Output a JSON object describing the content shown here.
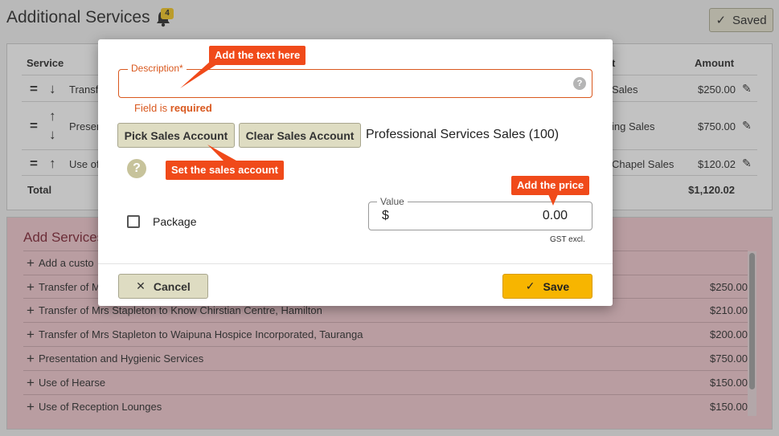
{
  "page": {
    "title": "Additional Services",
    "notification_count": "4",
    "saved_label": "Saved"
  },
  "table": {
    "headers": {
      "service": "Service",
      "account_tail": "t",
      "amount": "Amount"
    },
    "rows": [
      {
        "service": "Transf",
        "account": "Sales",
        "amount": "$250.00"
      },
      {
        "service": "Preser",
        "account": "ing Sales",
        "amount": "$750.00"
      },
      {
        "service": "Use of",
        "account": "Chapel Sales",
        "amount": "$120.02"
      }
    ],
    "total_label": "Total",
    "total_value": "$1,120.02"
  },
  "add_services": {
    "title": "Add Services",
    "items": [
      {
        "label": "Add a custo",
        "price": ""
      },
      {
        "label": "Transfer of M",
        "price": "$250.00"
      },
      {
        "label": "Transfer of Mrs Stapleton to Know Chirstian Centre, Hamilton",
        "price": "$210.00"
      },
      {
        "label": "Transfer of Mrs Stapleton to Waipuna Hospice Incorporated, Tauranga",
        "price": "$200.00"
      },
      {
        "label": "Presentation and Hygienic Services",
        "price": "$750.00"
      },
      {
        "label": "Use of Hearse",
        "price": "$150.00"
      },
      {
        "label": "Use of Reception Lounges",
        "price": "$150.00"
      }
    ]
  },
  "modal": {
    "description_label": "Description*",
    "description_value": "",
    "error_prefix": "Field is ",
    "error_strong": "required",
    "pick_account_label": "Pick Sales Account",
    "clear_account_label": "Clear Sales Account",
    "account_name": "Professional Services Sales (100)",
    "package_label": "Package",
    "package_checked": false,
    "value_label": "Value",
    "value_currency": "$",
    "value_amount": "0.00",
    "gst_note": "GST excl.",
    "cancel_label": "Cancel",
    "save_label": "Save"
  },
  "callouts": {
    "text": "Add the text here",
    "account": "Set the sales account",
    "price": "Add the price"
  },
  "colors": {
    "callout": "#f04a1a",
    "save": "#f7b500",
    "error": "#d9581e",
    "add_panel": "#f1c7cd"
  }
}
